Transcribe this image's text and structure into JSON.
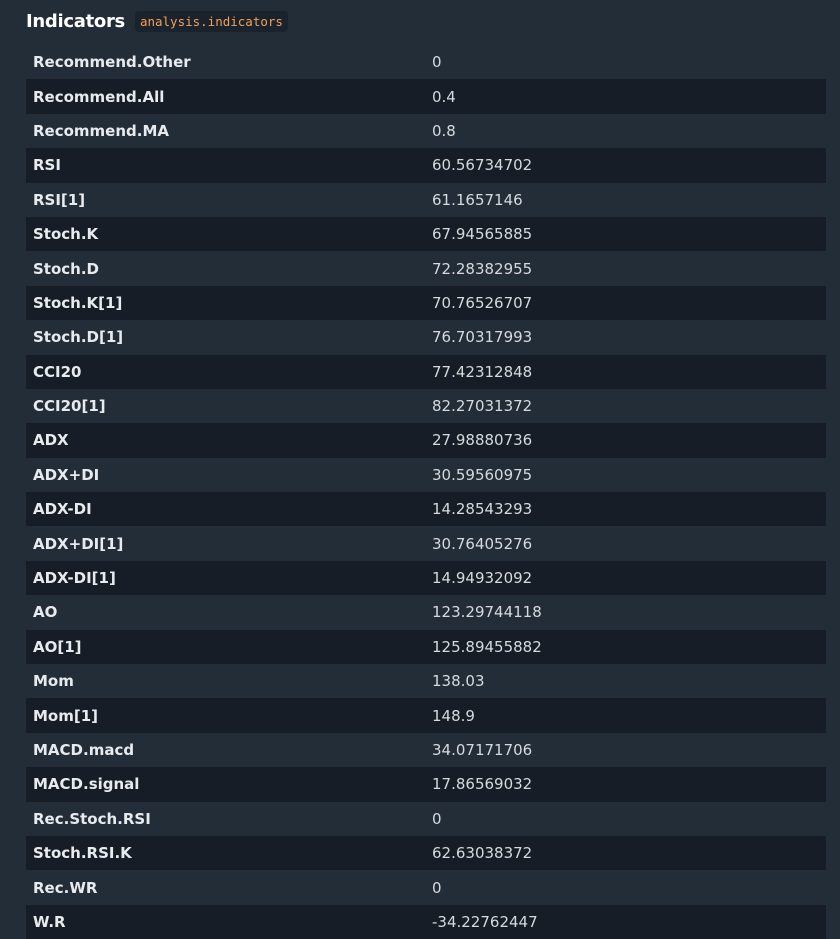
{
  "header": {
    "title": "Indicators",
    "code": "analysis.indicators"
  },
  "rows": [
    {
      "name": "Recommend.Other",
      "value": "0"
    },
    {
      "name": "Recommend.All",
      "value": "0.4"
    },
    {
      "name": "Recommend.MA",
      "value": "0.8"
    },
    {
      "name": "RSI",
      "value": "60.56734702"
    },
    {
      "name": "RSI[1]",
      "value": "61.1657146"
    },
    {
      "name": "Stoch.K",
      "value": "67.94565885"
    },
    {
      "name": "Stoch.D",
      "value": "72.28382955"
    },
    {
      "name": "Stoch.K[1]",
      "value": "70.76526707"
    },
    {
      "name": "Stoch.D[1]",
      "value": "76.70317993"
    },
    {
      "name": "CCI20",
      "value": "77.42312848"
    },
    {
      "name": "CCI20[1]",
      "value": "82.27031372"
    },
    {
      "name": "ADX",
      "value": "27.98880736"
    },
    {
      "name": "ADX+DI",
      "value": "30.59560975"
    },
    {
      "name": "ADX-DI",
      "value": "14.28543293"
    },
    {
      "name": "ADX+DI[1]",
      "value": "30.76405276"
    },
    {
      "name": "ADX-DI[1]",
      "value": "14.94932092"
    },
    {
      "name": "AO",
      "value": "123.29744118"
    },
    {
      "name": "AO[1]",
      "value": "125.89455882"
    },
    {
      "name": "Mom",
      "value": "138.03"
    },
    {
      "name": "Mom[1]",
      "value": "148.9"
    },
    {
      "name": "MACD.macd",
      "value": "34.07171706"
    },
    {
      "name": "MACD.signal",
      "value": "17.86569032"
    },
    {
      "name": "Rec.Stoch.RSI",
      "value": "0"
    },
    {
      "name": "Stoch.RSI.K",
      "value": "62.63038372"
    },
    {
      "name": "Rec.WR",
      "value": "0"
    },
    {
      "name": "W.R",
      "value": "-34.22762447"
    }
  ]
}
